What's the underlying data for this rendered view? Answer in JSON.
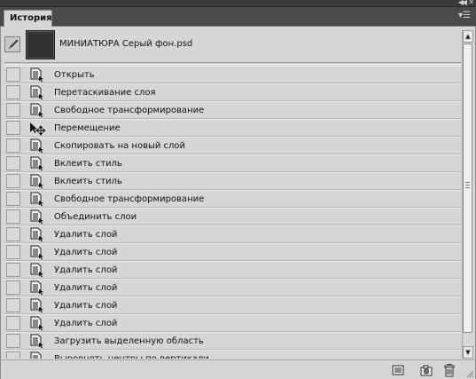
{
  "titlebar": {
    "collapse_glyph": "◀◀",
    "close_glyph": "✕"
  },
  "panel": {
    "tab_label": "История",
    "menu_glyph": "▾☰"
  },
  "snapshot": {
    "name": "МИНИАТЮРА Серый фон.psd",
    "icon": "brush-icon"
  },
  "history_states": [
    {
      "label": "Открыть",
      "icon": "history-state-icon"
    },
    {
      "label": "Перетаскивание слоя",
      "icon": "history-state-icon"
    },
    {
      "label": "Свободное трансформирование",
      "icon": "history-state-icon"
    },
    {
      "label": "Перемещение",
      "icon": "move-tool-icon"
    },
    {
      "label": "Скопировать на новый слой",
      "icon": "history-state-icon"
    },
    {
      "label": "Вклеить стиль",
      "icon": "history-state-icon"
    },
    {
      "label": "Вклеить стиль",
      "icon": "history-state-icon"
    },
    {
      "label": "Свободное трансформирование",
      "icon": "history-state-icon"
    },
    {
      "label": "Объединить слои",
      "icon": "history-state-icon"
    },
    {
      "label": "Удалить слой",
      "icon": "history-state-icon"
    },
    {
      "label": "Удалить слой",
      "icon": "history-state-icon"
    },
    {
      "label": "Удалить слой",
      "icon": "history-state-icon"
    },
    {
      "label": "Удалить слой",
      "icon": "history-state-icon"
    },
    {
      "label": "Удалить слой",
      "icon": "history-state-icon"
    },
    {
      "label": "Удалить слой",
      "icon": "history-state-icon"
    },
    {
      "label": "Загрузить выделенную область",
      "icon": "history-state-icon"
    },
    {
      "label": "Выровнять центры по вертикали",
      "icon": "history-state-icon"
    }
  ],
  "scrollbar": {
    "up_glyph": "▲",
    "down_glyph": "▼"
  },
  "footer": {
    "buttons": [
      {
        "name": "new-document-from-state-button",
        "icon": "new-document-icon"
      },
      {
        "name": "new-snapshot-button",
        "icon": "camera-icon"
      },
      {
        "name": "delete-state-button",
        "icon": "trash-icon"
      }
    ]
  },
  "colors": {
    "panel_bg": "#d6d6d6",
    "dark_chrome": "#4a4a4a"
  }
}
